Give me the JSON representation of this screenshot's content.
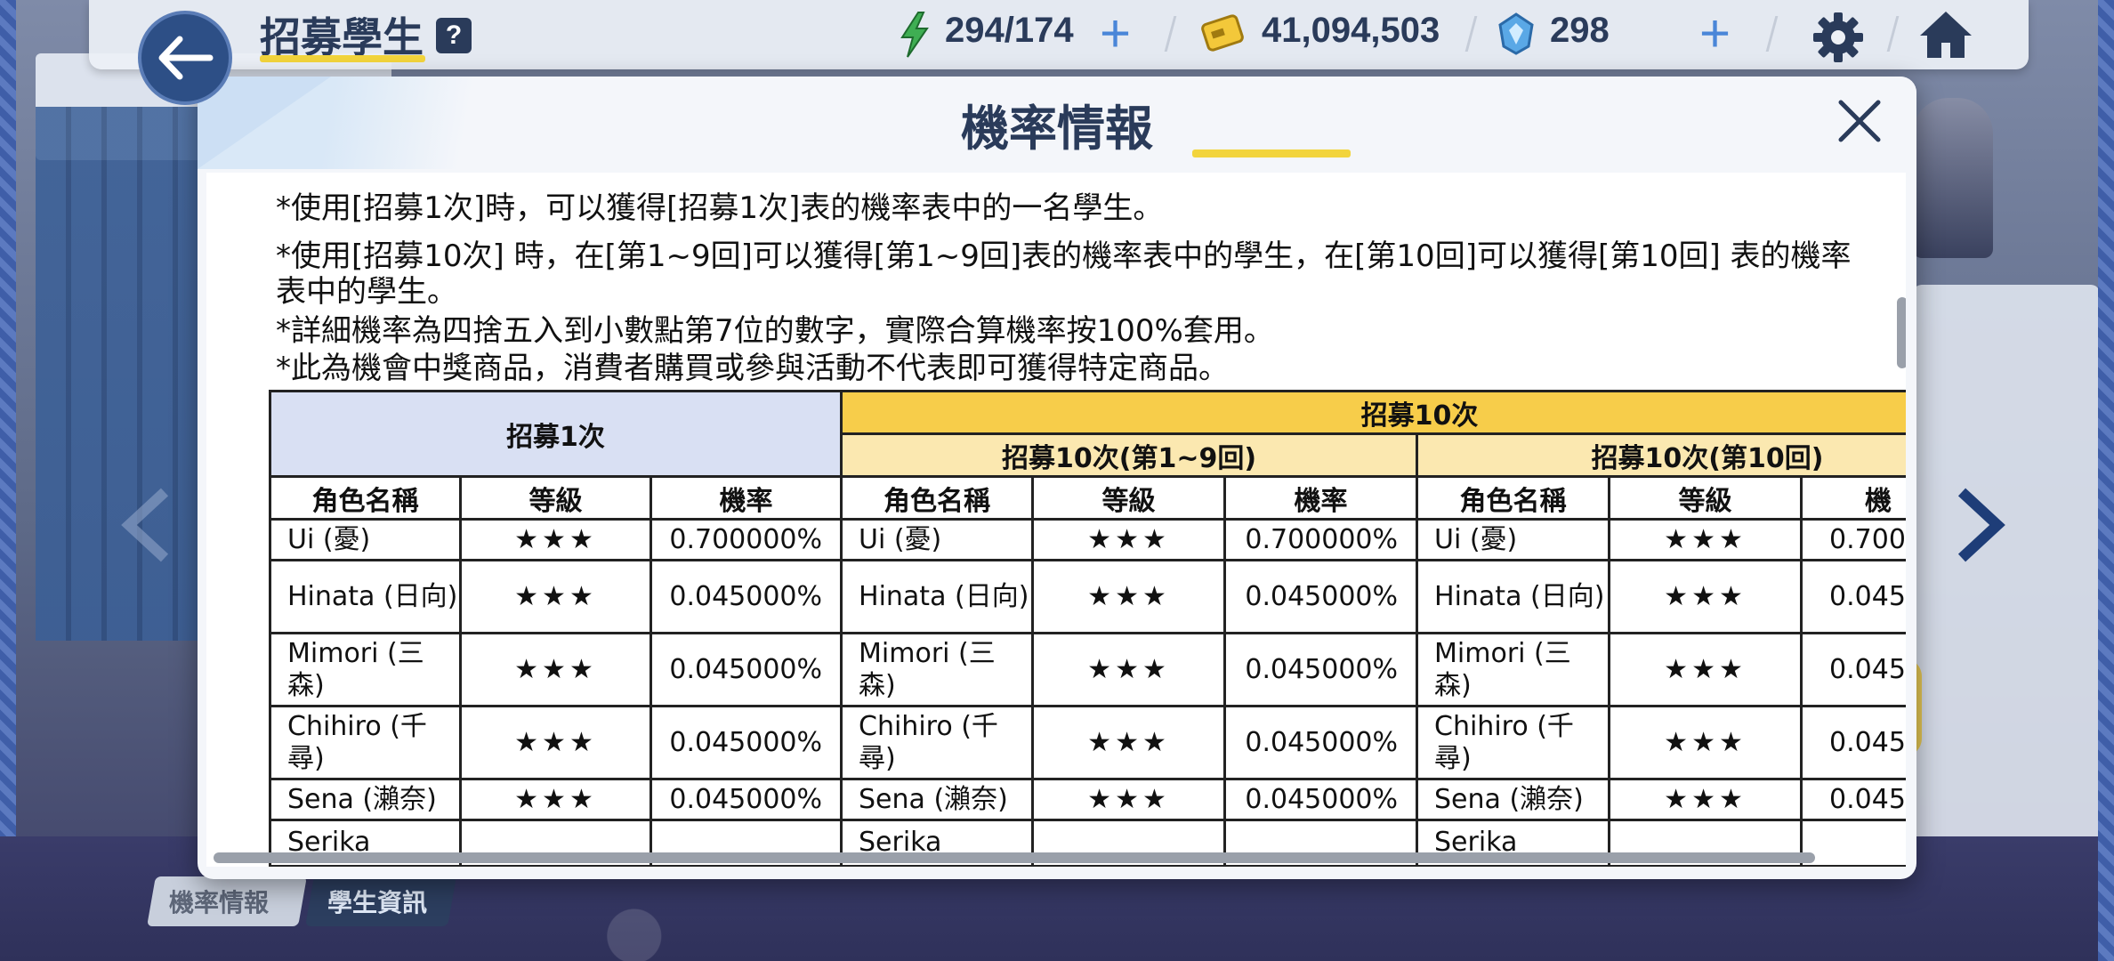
{
  "header": {
    "title": "招募學生",
    "help": "?",
    "ap": "294/174",
    "credits": "41,094,503",
    "gems": "298"
  },
  "bottom_tabs": [
    "機率情報",
    "學生資訊"
  ],
  "modal": {
    "title": "機率情報",
    "notes": [
      "*使用[招募1次]時，可以獲得[招募1次]表的機率表中的一名學生。",
      "*使用[招募10次] 時，在[第1~9回]可以獲得[第1~9回]表的機率表中的學生，在[第10回]可以獲得[第10回] 表的機率",
      "表中的學生。",
      "*詳細機率為四捨五入到小數點第7位的數字，實際合算機率按100%套用。",
      "*此為機會中獎商品，消費者購買或參與活動不代表即可獲得特定商品。"
    ],
    "table": {
      "group_1x": "招募1次",
      "group_10x": "招募10次",
      "sub_1_9": "招募10次(第1~9回)",
      "sub_10": "招募10次(第10回)",
      "col_name": "角色名稱",
      "col_grade": "等級",
      "col_rate": "機率",
      "col_rate_cut": "機",
      "rows": [
        {
          "name": "Ui (憂)",
          "stars": "★★★",
          "rate": "0.700000%",
          "rate_cut": "0.700"
        },
        {
          "name": "Hinata (日向)",
          "stars": "★★★",
          "rate": "0.045000%",
          "rate_cut": "0.045"
        },
        {
          "name": "Mimori (三森)",
          "stars": "★★★",
          "rate": "0.045000%",
          "rate_cut": "0.045"
        },
        {
          "name": "Chihiro (千尋)",
          "stars": "★★★",
          "rate": "0.045000%",
          "rate_cut": "0.045"
        },
        {
          "name": "Sena (瀨奈)",
          "stars": "★★★",
          "rate": "0.045000%",
          "rate_cut": "0.045"
        },
        {
          "name": "Serika",
          "stars": "",
          "rate": "",
          "rate_cut": ""
        }
      ]
    }
  },
  "colors": {
    "accent_yellow": "#f2d43c",
    "navy": "#2a3b5a",
    "header_10x": "#f7cd4a",
    "header_1x": "#d9e0f3"
  }
}
